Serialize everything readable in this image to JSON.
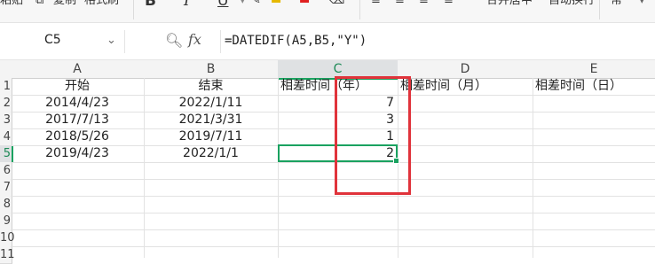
{
  "toolbar": {
    "items": [
      "粘贴",
      "复制",
      "格式刷",
      "B",
      "I",
      "U",
      "合并居中",
      "自动换行",
      "常"
    ]
  },
  "formula_bar": {
    "name_box": "C5",
    "fx_label": "fx",
    "formula": "=DATEDIF(A5,B5,\"Y\")"
  },
  "sheet": {
    "columns": [
      "A",
      "B",
      "C",
      "D",
      "E"
    ],
    "row_numbers": [
      "1",
      "2",
      "3",
      "4",
      "5",
      "6",
      "7",
      "8",
      "9",
      "10",
      "11"
    ],
    "headers": [
      "开始",
      "结束",
      "相差时间（年）",
      "相差时间（月）",
      "相差时间（日）"
    ],
    "rows": [
      {
        "start": "2014/4/23",
        "end": "2022/1/11",
        "years": "7"
      },
      {
        "start": "2017/7/13",
        "end": "2021/3/31",
        "years": "3"
      },
      {
        "start": "2018/5/26",
        "end": "2019/7/11",
        "years": "1"
      },
      {
        "start": "2019/4/23",
        "end": "2022/1/1",
        "years": "2"
      }
    ],
    "active_cell": "C5",
    "colors": {
      "selection": "#1aa260",
      "highlight_box": "#e0333b"
    }
  }
}
